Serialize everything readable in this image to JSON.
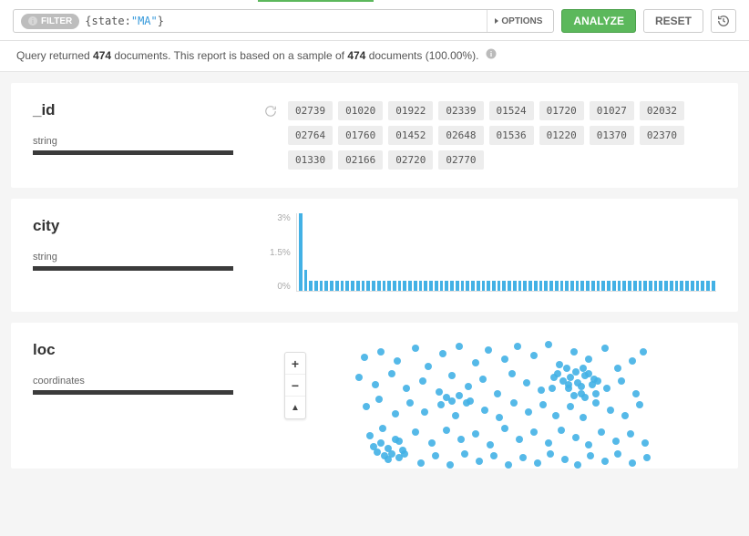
{
  "filter": {
    "badge_label": "FILTER",
    "query_brace_open": "{",
    "query_key": "state",
    "query_colon": ":",
    "query_value": "\"MA\"",
    "query_brace_close": "}",
    "options_label": "OPTIONS",
    "analyze_label": "ANALYZE",
    "reset_label": "RESET"
  },
  "status": {
    "pre": "Query returned ",
    "count": "474",
    "mid": " documents. This report is based on a sample of ",
    "sample": "474",
    "post": " documents (100.00%)."
  },
  "fields": {
    "id": {
      "name": "_id",
      "type": "string",
      "tags": [
        "02739",
        "01020",
        "01922",
        "02339",
        "01524",
        "01720",
        "01027",
        "02032",
        "02764",
        "01760",
        "01452",
        "02648",
        "01536",
        "01220",
        "01370",
        "02370",
        "01330",
        "02166",
        "02720",
        "02770"
      ]
    },
    "city": {
      "name": "city",
      "type": "string"
    },
    "loc": {
      "name": "loc",
      "type": "coordinates",
      "zoom_in": "+",
      "zoom_out": "−",
      "compass": "▲"
    }
  },
  "chart_data": {
    "type": "bar",
    "title": "city",
    "xlabel": "",
    "ylabel": "",
    "ylim": [
      0,
      3
    ],
    "y_ticks": [
      "3%",
      "1.5%",
      "0%"
    ],
    "categories_note": "individual city values (not labeled on chart)",
    "values": [
      3.0,
      0.8,
      0.4,
      0.4,
      0.4,
      0.4,
      0.4,
      0.4,
      0.4,
      0.4,
      0.4,
      0.4,
      0.4,
      0.4,
      0.4,
      0.4,
      0.4,
      0.4,
      0.4,
      0.4,
      0.4,
      0.4,
      0.4,
      0.4,
      0.4,
      0.4,
      0.4,
      0.4,
      0.4,
      0.4,
      0.4,
      0.4,
      0.4,
      0.4,
      0.4,
      0.4,
      0.4,
      0.4,
      0.4,
      0.4,
      0.4,
      0.4,
      0.4,
      0.4,
      0.4,
      0.4,
      0.4,
      0.4,
      0.4,
      0.4,
      0.4,
      0.4,
      0.4,
      0.4,
      0.4,
      0.4,
      0.4,
      0.4,
      0.4,
      0.4,
      0.4,
      0.4,
      0.4,
      0.4,
      0.4,
      0.4,
      0.4,
      0.4,
      0.4,
      0.4,
      0.4,
      0.4,
      0.4,
      0.4,
      0.4,
      0.4,
      0.4,
      0.4,
      0.4,
      0.4
    ]
  },
  "map_points": [
    [
      54,
      18
    ],
    [
      72,
      12
    ],
    [
      90,
      22
    ],
    [
      110,
      8
    ],
    [
      124,
      28
    ],
    [
      140,
      14
    ],
    [
      158,
      6
    ],
    [
      176,
      24
    ],
    [
      190,
      10
    ],
    [
      208,
      20
    ],
    [
      222,
      6
    ],
    [
      240,
      16
    ],
    [
      256,
      4
    ],
    [
      268,
      26
    ],
    [
      284,
      12
    ],
    [
      300,
      20
    ],
    [
      318,
      8
    ],
    [
      332,
      30
    ],
    [
      348,
      22
    ],
    [
      360,
      12
    ],
    [
      48,
      40
    ],
    [
      66,
      48
    ],
    [
      84,
      36
    ],
    [
      100,
      52
    ],
    [
      118,
      44
    ],
    [
      136,
      56
    ],
    [
      150,
      38
    ],
    [
      168,
      50
    ],
    [
      184,
      42
    ],
    [
      200,
      58
    ],
    [
      216,
      36
    ],
    [
      232,
      46
    ],
    [
      248,
      54
    ],
    [
      262,
      40
    ],
    [
      278,
      48
    ],
    [
      292,
      58
    ],
    [
      306,
      42
    ],
    [
      320,
      52
    ],
    [
      336,
      44
    ],
    [
      352,
      58
    ],
    [
      56,
      72
    ],
    [
      70,
      64
    ],
    [
      88,
      80
    ],
    [
      104,
      68
    ],
    [
      120,
      78
    ],
    [
      138,
      70
    ],
    [
      154,
      82
    ],
    [
      170,
      66
    ],
    [
      186,
      76
    ],
    [
      202,
      84
    ],
    [
      218,
      68
    ],
    [
      234,
      78
    ],
    [
      250,
      70
    ],
    [
      264,
      82
    ],
    [
      280,
      72
    ],
    [
      294,
      84
    ],
    [
      308,
      68
    ],
    [
      324,
      76
    ],
    [
      340,
      82
    ],
    [
      356,
      70
    ],
    [
      60,
      104
    ],
    [
      74,
      96
    ],
    [
      92,
      110
    ],
    [
      110,
      100
    ],
    [
      128,
      112
    ],
    [
      144,
      98
    ],
    [
      160,
      108
    ],
    [
      176,
      102
    ],
    [
      192,
      114
    ],
    [
      208,
      96
    ],
    [
      224,
      108
    ],
    [
      240,
      100
    ],
    [
      256,
      112
    ],
    [
      270,
      98
    ],
    [
      286,
      106
    ],
    [
      300,
      114
    ],
    [
      314,
      100
    ],
    [
      330,
      110
    ],
    [
      346,
      102
    ],
    [
      362,
      112
    ],
    [
      80,
      130
    ],
    [
      98,
      124
    ],
    [
      116,
      134
    ],
    [
      132,
      126
    ],
    [
      148,
      136
    ],
    [
      164,
      124
    ],
    [
      180,
      132
    ],
    [
      196,
      126
    ],
    [
      212,
      136
    ],
    [
      228,
      128
    ],
    [
      244,
      134
    ],
    [
      258,
      124
    ],
    [
      274,
      130
    ],
    [
      288,
      136
    ],
    [
      302,
      126
    ],
    [
      318,
      132
    ],
    [
      332,
      124
    ],
    [
      348,
      134
    ],
    [
      364,
      128
    ],
    [
      280,
      40
    ],
    [
      288,
      46
    ],
    [
      296,
      38
    ],
    [
      304,
      48
    ],
    [
      292,
      50
    ],
    [
      300,
      36
    ],
    [
      286,
      34
    ],
    [
      278,
      52
    ],
    [
      294,
      30
    ],
    [
      310,
      44
    ],
    [
      284,
      60
    ],
    [
      296,
      62
    ],
    [
      308,
      58
    ],
    [
      272,
      44
    ],
    [
      266,
      36
    ],
    [
      260,
      52
    ],
    [
      276,
      30
    ],
    [
      72,
      112
    ],
    [
      80,
      118
    ],
    [
      88,
      108
    ],
    [
      96,
      120
    ],
    [
      68,
      122
    ],
    [
      76,
      126
    ],
    [
      84,
      124
    ],
    [
      92,
      128
    ],
    [
      64,
      116
    ],
    [
      150,
      66
    ],
    [
      158,
      60
    ],
    [
      166,
      68
    ],
    [
      144,
      62
    ]
  ]
}
